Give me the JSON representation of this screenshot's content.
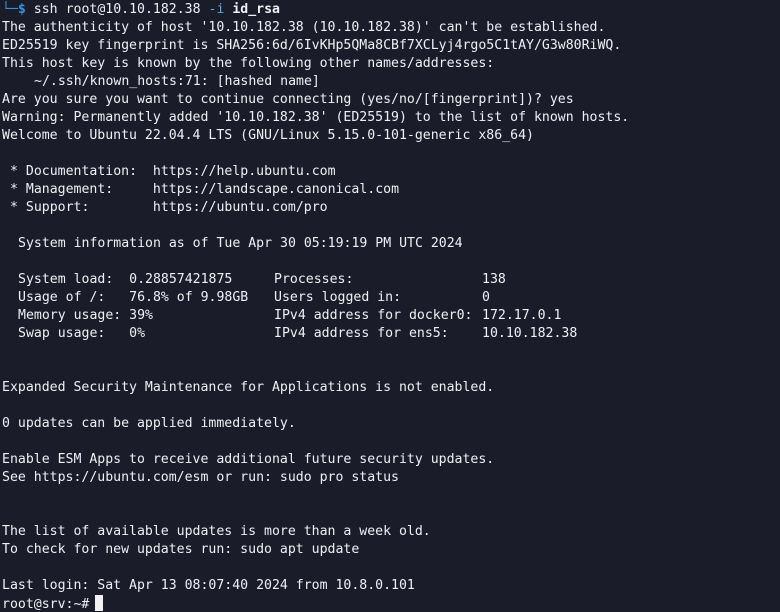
{
  "prompt": {
    "corner": "└─",
    "symbol": "$",
    "command": "ssh",
    "target": "root@10.10.182.38",
    "flag": "-i",
    "key_file": "id_rsa"
  },
  "output": {
    "authenticity": "The authenticity of host '10.10.182.38 (10.10.182.38)' can't be established.",
    "fingerprint": "ED25519 key fingerprint is SHA256:6d/6IvKHp5QMa8CBf7XCLyj4rgo5C1tAY/G3w80RiWQ.",
    "known_by": "This host key is known by the following other names/addresses:",
    "known_hosts": "~/.ssh/known_hosts:71: [hashed name]",
    "confirm": "Are you sure you want to continue connecting (yes/no/[fingerprint])? yes",
    "warning": "Warning: Permanently added '10.10.182.38' (ED25519) to the list of known hosts.",
    "welcome": "Welcome to Ubuntu 22.04.4 LTS (GNU/Linux 5.15.0-101-generic x86_64)"
  },
  "links": [
    {
      "label": "* Documentation:  ",
      "url": "https://help.ubuntu.com"
    },
    {
      "label": "* Management:     ",
      "url": "https://landscape.canonical.com"
    },
    {
      "label": "* Support:        ",
      "url": "https://ubuntu.com/pro"
    }
  ],
  "sysinfo": {
    "heading": "System information as of Tue Apr 30 05:19:19 PM UTC 2024",
    "rows": [
      {
        "left": "System load:  0.28857421875",
        "mid": "Processes:",
        "right": "138"
      },
      {
        "left": "Usage of /:   76.8% of 9.98GB",
        "mid": "Users logged in:",
        "right": "0"
      },
      {
        "left": "Memory usage: 39%",
        "mid": "IPv4 address for docker0:",
        "right": "172.17.0.1"
      },
      {
        "left": "Swap usage:   0%",
        "mid": "IPv4 address for ens5:",
        "right": "10.10.182.38"
      }
    ]
  },
  "messages": {
    "esm_status": "Expanded Security Maintenance for Applications is not enabled.",
    "updates": "0 updates can be applied immediately.",
    "esm_enable": "Enable ESM Apps to receive additional future security updates.",
    "esm_see": "See https://ubuntu.com/esm or run: sudo pro status",
    "old_list": "The list of available updates is more than a week old.",
    "check_updates": "To check for new updates run: sudo apt update",
    "last_login": "Last login: Sat Apr 13 08:07:40 2024 from 10.8.0.101"
  },
  "remote_prompt": "root@srv:~#",
  "colors": {
    "background": "#1b1c2a",
    "text": "#eef0f4",
    "prompt_blue": "#3f8fd8",
    "flag_blue": "#5aa6e0"
  }
}
